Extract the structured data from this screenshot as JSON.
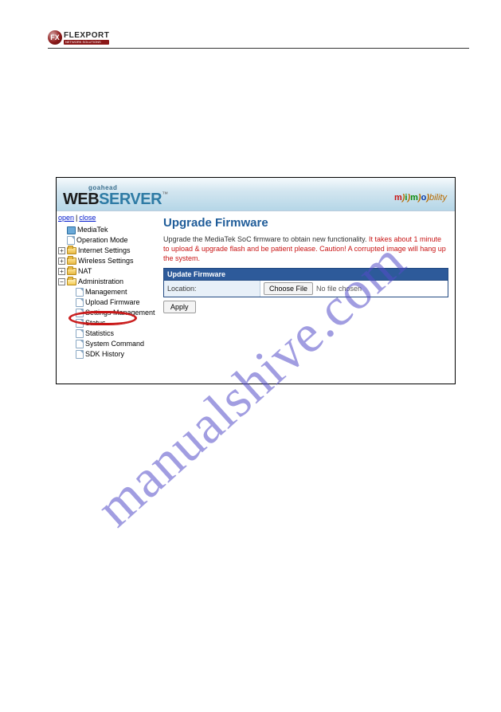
{
  "brand": {
    "logo_initials": "FX",
    "logo_text": "FLEXPORT",
    "logo_sub": "NETWORK SOLUTIONS"
  },
  "watermark": "manualshive.com",
  "webserver": {
    "goahead": "goahead",
    "web": "WEB",
    "server": "SERVER",
    "tm": "™",
    "mimo": {
      "m1": "m",
      "m2": "m",
      "m3": "o",
      "tail": "bility"
    }
  },
  "tree": {
    "open": "open",
    "close": "close",
    "root": "MediaTek",
    "items": [
      "Operation Mode",
      "Internet Settings",
      "Wireless Settings",
      "NAT",
      "Administration"
    ],
    "admin_children": [
      "Management",
      "Upload Firmware",
      "Settings Management",
      "Status",
      "Statistics",
      "System Command",
      "SDK History"
    ]
  },
  "main": {
    "title": "Upgrade Firmware",
    "desc_black": "Upgrade the MediaTek SoC firmware to obtain new functionality.",
    "desc_red": "It takes about 1 minute to upload & upgrade flash and be patient please. Caution! A corrupted image will hang up the system.",
    "table_header": "Update Firmware",
    "location_label": "Location:",
    "choose_file": "Choose File",
    "no_file": "No file chosen",
    "apply": "Apply"
  }
}
